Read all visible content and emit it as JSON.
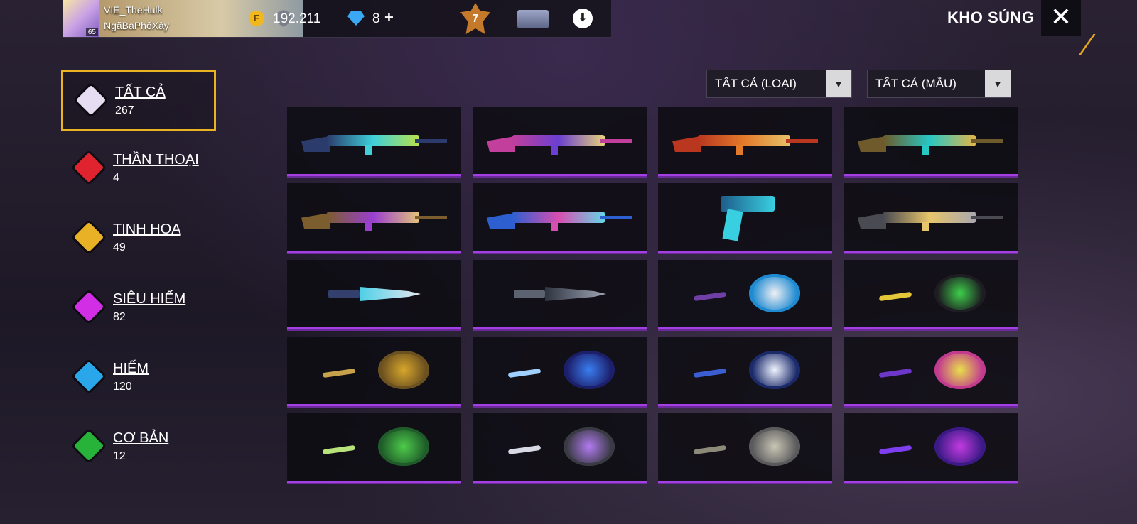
{
  "header": {
    "level": "65",
    "player_name": "VIE_TheHulk",
    "guild_name": "NgãBaPhốXây",
    "coin_icon": "F",
    "gold": "192.211",
    "diamonds": "8",
    "plus": "+",
    "rank": "7",
    "title": "KHO SÚNG",
    "close": "✕"
  },
  "categories": [
    {
      "label": "TẤT CẢ",
      "count": "267",
      "color": "#e6ddf2",
      "active": true
    },
    {
      "label": "THẦN THOẠI",
      "count": "4",
      "color": "#e0242f"
    },
    {
      "label": "TINH HOA",
      "count": "49",
      "color": "#e8b126"
    },
    {
      "label": "SIÊU HIẾM",
      "count": "82",
      "color": "#d12ee6"
    },
    {
      "label": "HIẾM",
      "count": "120",
      "color": "#2aa6ea"
    },
    {
      "label": "CƠ BẢN",
      "count": "12",
      "color": "#27b33a"
    }
  ],
  "filters": {
    "type": "TẤT CẢ (LOẠI)",
    "model": "TẤT CẢ (MẪU)"
  },
  "items": [
    {
      "kind": "gun",
      "colors": [
        "#2b3b6c",
        "#3fd0d9",
        "#b8e24c"
      ]
    },
    {
      "kind": "gun",
      "colors": [
        "#c23f9c",
        "#6b3fd0",
        "#e6d27a"
      ]
    },
    {
      "kind": "gun",
      "colors": [
        "#b9361f",
        "#e37a2a",
        "#e6c26a"
      ]
    },
    {
      "kind": "gun",
      "colors": [
        "#6e5a2a",
        "#27c7c4",
        "#e3b64a"
      ]
    },
    {
      "kind": "gun",
      "colors": [
        "#7b5d2e",
        "#9a3fd0",
        "#e3c37a"
      ]
    },
    {
      "kind": "gun",
      "colors": [
        "#2d5fd0",
        "#d74fb0",
        "#66d6e6"
      ]
    },
    {
      "kind": "pistol",
      "colors": [
        "#1e5c8a",
        "#38d0e0",
        "#14222e"
      ]
    },
    {
      "kind": "gun",
      "colors": [
        "#4a4a52",
        "#e7c56a",
        "#a8a8b0"
      ]
    },
    {
      "kind": "knife",
      "colors": [
        "#33406e",
        "#e8e8f0",
        "#4dd0e6"
      ]
    },
    {
      "kind": "knife",
      "colors": [
        "#5c6270",
        "#9fa6b5",
        "#2f3440"
      ]
    },
    {
      "kind": "pan",
      "colors": [
        "#1f8ad0",
        "#f0f0f5",
        "#6f3fa6"
      ]
    },
    {
      "kind": "pan",
      "colors": [
        "#1d1d22",
        "#3ecf4a",
        "#e5c83a"
      ]
    },
    {
      "kind": "pan",
      "colors": [
        "#6b5020",
        "#d9a72c",
        "#c8a24a"
      ]
    },
    {
      "kind": "pan",
      "colors": [
        "#1c1f6a",
        "#3a7ef0",
        "#9fd0ff"
      ]
    },
    {
      "kind": "pan",
      "colors": [
        "#1b2a6a",
        "#f0f4ff",
        "#3b5fd0"
      ]
    },
    {
      "kind": "pan",
      "colors": [
        "#c23b8e",
        "#e8e04a",
        "#6d37c9"
      ]
    },
    {
      "kind": "pan",
      "colors": [
        "#1f5c2a",
        "#4ecb4a",
        "#b8e27a"
      ]
    },
    {
      "kind": "pan",
      "colors": [
        "#3a3a44",
        "#b17bf0",
        "#d9d9e6"
      ]
    },
    {
      "kind": "pan",
      "colors": [
        "#5a5a5c",
        "#c9c6b5",
        "#8d8a7a"
      ]
    },
    {
      "kind": "pan",
      "colors": [
        "#3b1a86",
        "#c23be0",
        "#7f3ff0"
      ]
    }
  ]
}
